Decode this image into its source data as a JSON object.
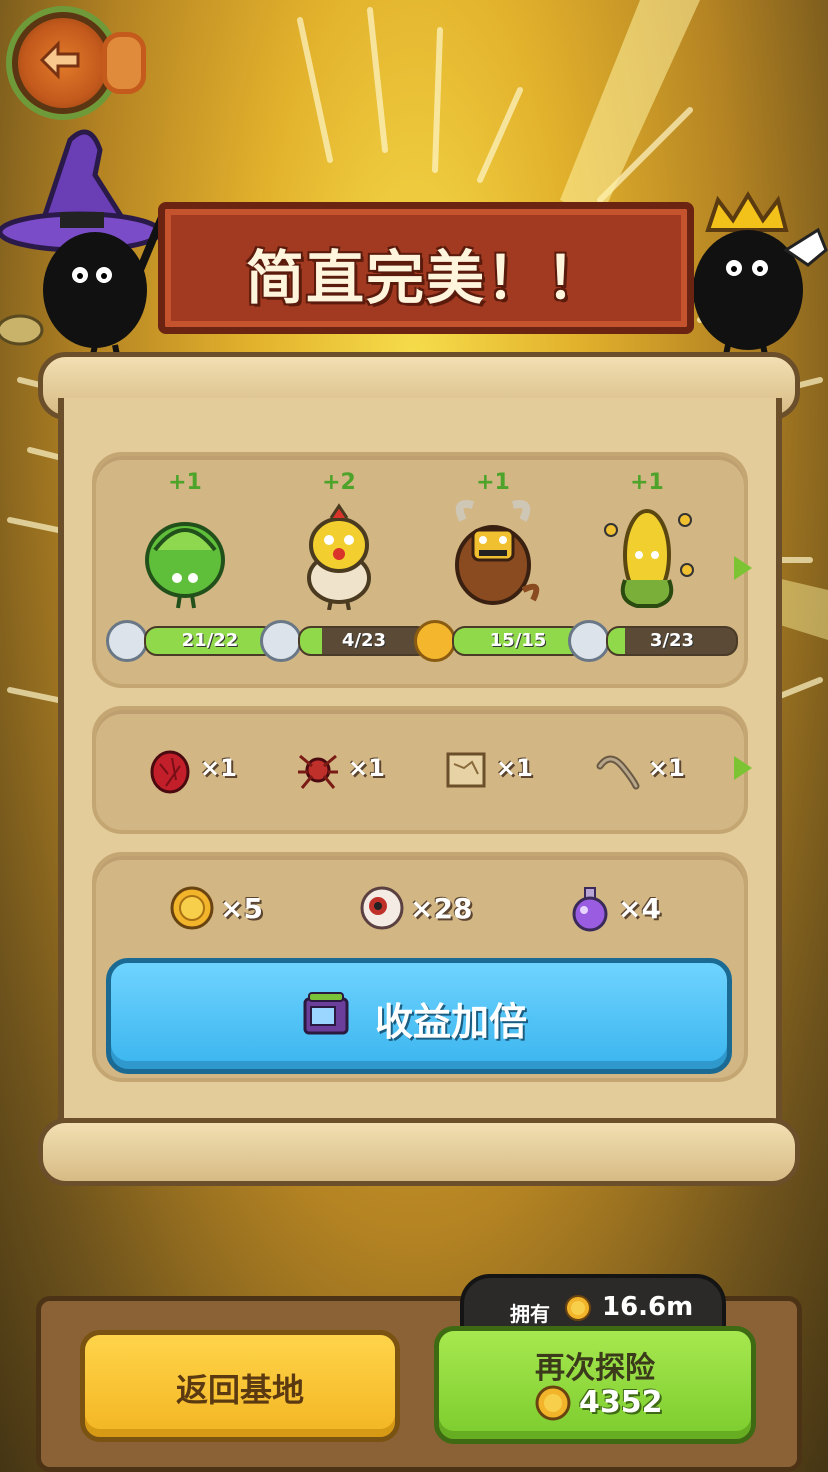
{
  "banner": {
    "title": "简直完美！！"
  },
  "monsters": [
    {
      "name_icon": "lettuce-monster-icon",
      "plus": "+1",
      "progress": "21/22",
      "fraction": 0.95,
      "badge": "silver"
    },
    {
      "name_icon": "chick-egg-monster-icon",
      "plus": "+2",
      "progress": "4/23",
      "fraction": 0.17,
      "badge": "silver"
    },
    {
      "name_icon": "yak-monster-icon",
      "plus": "+1",
      "progress": "15/15",
      "fraction": 1.0,
      "badge": "gold"
    },
    {
      "name_icon": "corn-monster-icon",
      "plus": "+1",
      "progress": "3/23",
      "fraction": 0.13,
      "badge": "silver"
    }
  ],
  "items": [
    {
      "icon": "red-egg-icon",
      "qty": "×1"
    },
    {
      "icon": "spider-icon",
      "qty": "×1"
    },
    {
      "icon": "map-scroll-icon",
      "qty": "×1"
    },
    {
      "icon": "worm-icon",
      "qty": "×1"
    }
  ],
  "resources": [
    {
      "icon": "gold-coin-icon",
      "qty": "×5"
    },
    {
      "icon": "eyeball-icon",
      "qty": "×28"
    },
    {
      "icon": "purple-potion-icon",
      "qty": "×4"
    }
  ],
  "double_button": {
    "label": "收益加倍"
  },
  "owned": {
    "label": "拥有",
    "value": "16.6m"
  },
  "home_button": {
    "label": "返回基地"
  },
  "again_button": {
    "label": "再次探险",
    "cost": "4352"
  },
  "colors": {
    "banner": "#a23a21",
    "double": "#3ab5ee",
    "again": "#7ccc2e",
    "home": "#f3b522"
  }
}
